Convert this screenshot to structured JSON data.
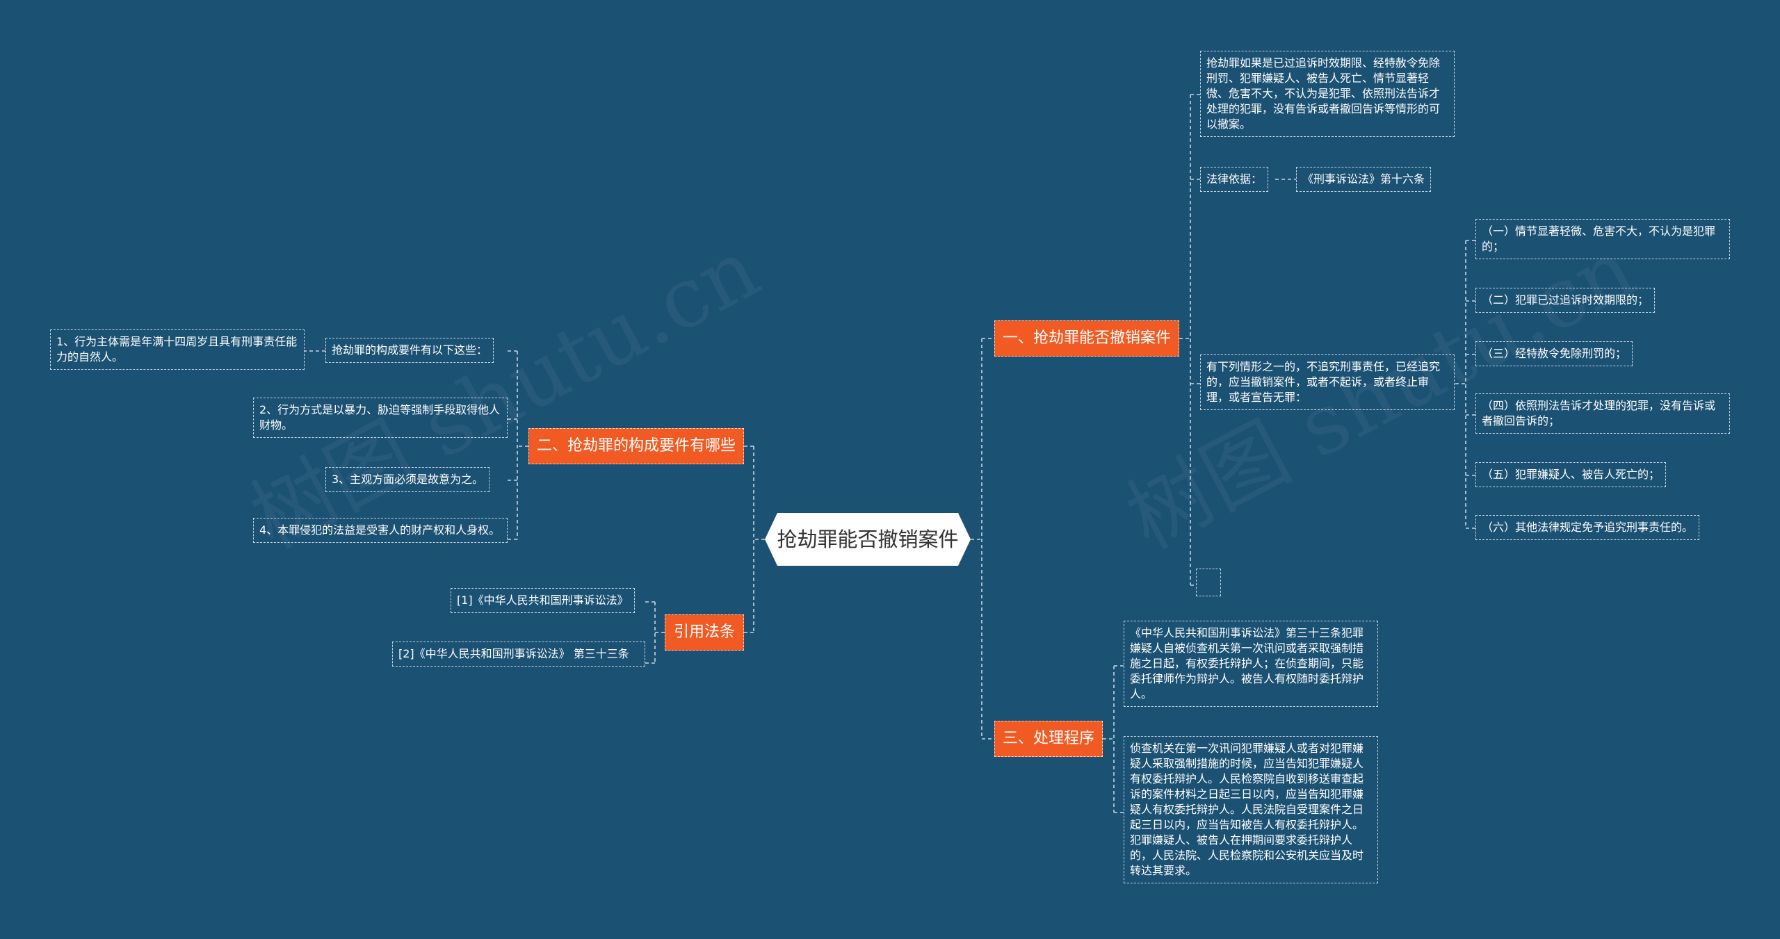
{
  "watermark": "树图 shutu.cn",
  "root": {
    "label": "抢劫罪能否撤销案件"
  },
  "branches": {
    "b1": {
      "label": "一、抢劫罪能否撤销案件",
      "text1": "抢劫罪如果是已过追诉时效期限、经特赦令免除刑罚、犯罪嫌疑人、被告人死亡、情节显著轻微、危害不大，不认为是犯罪、依照刑法告诉才处理的犯罪，没有告诉或者撤回告诉等情形的可以撤案。",
      "law_label": "法律依据：",
      "law_ref": "《刑事诉讼法》第十六条",
      "situations_intro": "有下列情形之一的，不追究刑事责任，已经追究的，应当撤销案件，或者不起诉，或者终止审理，或者宣告无罪：",
      "situations": [
        "（一）情节显著轻微、危害不大，不认为是犯罪的；",
        "（二）犯罪已过追诉时效期限的；",
        "（三）经特赦令免除刑罚的；",
        "（四）依照刑法告诉才处理的犯罪，没有告诉或者撤回告诉的；",
        "（五）犯罪嫌疑人、被告人死亡的；",
        "（六）其他法律规定免予追究刑事责任的。"
      ],
      "empty": ""
    },
    "b2": {
      "label": "二、抢劫罪的构成要件有哪些",
      "intro": "抢劫罪的构成要件有以下这些：",
      "items": [
        "1、行为主体需是年满十四周岁且具有刑事责任能力的自然人。",
        "2、行为方式是以暴力、胁迫等强制手段取得他人财物。",
        "3、主观方面必须是故意为之。",
        "4、本罪侵犯的法益是受害人的财产权和人身权。"
      ]
    },
    "b3": {
      "label": "三、处理程序",
      "items": [
        "《中华人民共和国刑事诉讼法》第三十三条犯罪嫌疑人自被侦查机关第一次讯问或者采取强制措施之日起，有权委托辩护人；在侦查期间，只能委托律师作为辩护人。被告人有权随时委托辩护人。",
        "侦查机关在第一次讯问犯罪嫌疑人或者对犯罪嫌疑人采取强制措施的时候，应当告知犯罪嫌疑人有权委托辩护人。人民检察院自收到移送审查起诉的案件材料之日起三日以内，应当告知犯罪嫌疑人有权委托辩护人。人民法院自受理案件之日起三日以内，应当告知被告人有权委托辩护人。犯罪嫌疑人、被告人在押期间要求委托辩护人的，人民法院、人民检察院和公安机关应当及时转达其要求。"
      ]
    },
    "b4": {
      "label": "引用法条",
      "items": [
        "[1]《中华人民共和国刑事诉讼法》",
        "[2]《中华人民共和国刑事诉讼法》 第三十三条"
      ]
    }
  },
  "colors": {
    "background": "#1b5173",
    "branch": "#f15a22",
    "root": "#ffffff",
    "line": "#c7d6e1"
  }
}
